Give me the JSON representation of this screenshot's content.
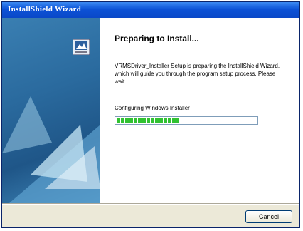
{
  "window": {
    "title": "InstallShield Wizard"
  },
  "main": {
    "heading": "Preparing to Install...",
    "description": "VRMSDriver_Installer Setup is preparing the InstallShield Wizard, which will guide you through the program setup process.  Please wait.",
    "status": "Configuring Windows Installer",
    "progress_fraction": 0.45
  },
  "buttons": {
    "cancel_label": "Cancel"
  },
  "icons": {
    "wizard": "installer-computer-icon"
  }
}
